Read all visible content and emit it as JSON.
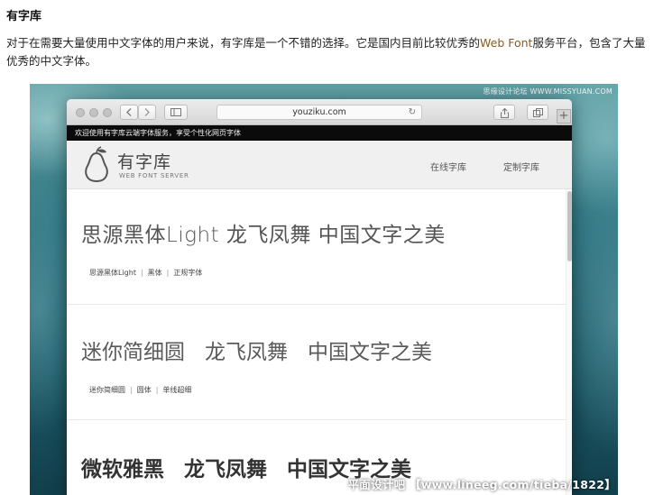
{
  "article": {
    "title": "有字库",
    "intro_part1": "对于在需要大量使用中文字体的用户来说，有字库是一个不错的选择。它是国内目前比较优秀的",
    "intro_highlight": "Web Font",
    "intro_part2": "服务平台，包含了大量优秀的中文字体。"
  },
  "watermark": {
    "top": "思缘设计论坛 WWW.MISSYUAN.COM",
    "bottom": "平面设计吧 【www.lineeg.com/tieba/1822】"
  },
  "browser": {
    "url": "youziku.com",
    "reload_glyph": "↻",
    "new_tab_glyph": "+"
  },
  "site": {
    "notice": "欢迎使用有字库云端字体服务，享受个性化网页字体",
    "logo_name": "有字库",
    "logo_sub": "WEB FONT SERVER",
    "nav": [
      "在线字库",
      "定制字库"
    ]
  },
  "fonts": [
    {
      "sample": [
        "思源黑体Light 龙飞凤舞 中国文字之美"
      ],
      "tags": [
        "思源黑体Light",
        "黑体",
        "正规字体"
      ]
    },
    {
      "sample": [
        "迷你简细圆",
        "龙飞凤舞",
        "中国文字之美"
      ],
      "tags": [
        "迷你简细圆",
        "圆体",
        "单线超细"
      ]
    },
    {
      "sample": [
        "微软雅黑",
        "龙飞凤舞",
        "中国文字之美"
      ],
      "tags": []
    }
  ],
  "colors": {
    "highlight_text": "#8a5a1e",
    "notice_bar": "#0b0b0b",
    "ocean": "#2f7682"
  }
}
